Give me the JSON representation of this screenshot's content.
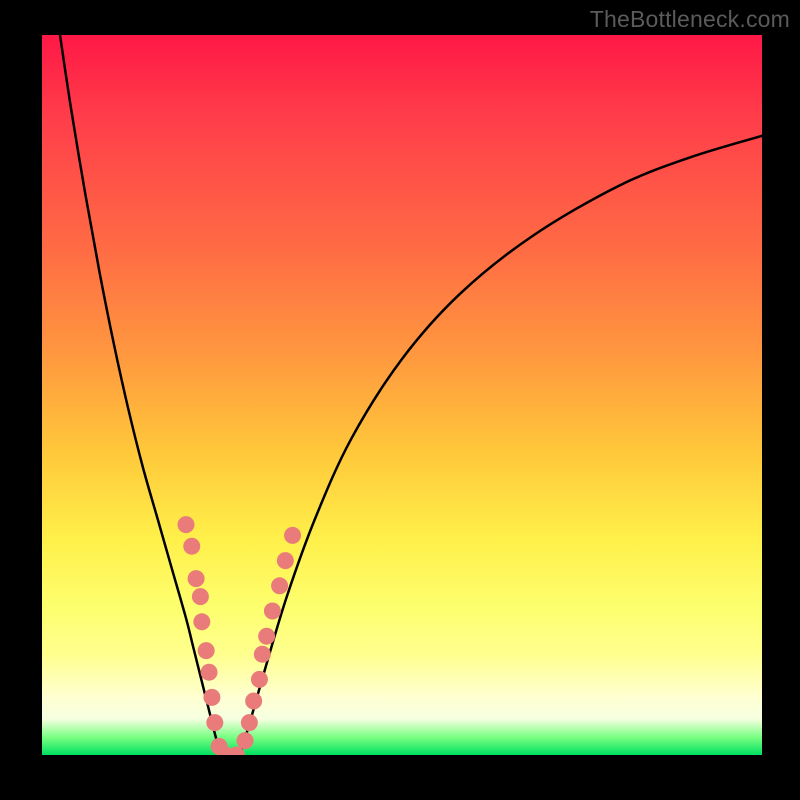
{
  "watermark": {
    "text": "TheBottleneck.com"
  },
  "chart_data": {
    "type": "line",
    "title": "",
    "xlabel": "",
    "ylabel": "",
    "xlim": [
      0,
      100
    ],
    "ylim": [
      0,
      100
    ],
    "series": [
      {
        "name": "left-curve",
        "x": [
          2.5,
          4,
          6,
          8,
          10,
          12,
          14,
          16,
          18,
          20,
          21,
          22,
          23,
          24,
          24.8
        ],
        "y": [
          100,
          90,
          78,
          67,
          57,
          48,
          40,
          33,
          26,
          19,
          15,
          11,
          7,
          3,
          0
        ]
      },
      {
        "name": "right-curve",
        "x": [
          27.5,
          29,
          31,
          34,
          38,
          43,
          50,
          58,
          68,
          80,
          90,
          100
        ],
        "y": [
          0,
          5,
          12,
          22,
          33,
          44,
          55,
          64,
          72,
          79,
          83,
          86
        ]
      },
      {
        "name": "floor",
        "x": [
          24.8,
          27.5
        ],
        "y": [
          0,
          0
        ]
      }
    ],
    "markers": [
      {
        "name": "cluster",
        "color": "#e97c7a",
        "points": [
          [
            20.0,
            32
          ],
          [
            20.8,
            29
          ],
          [
            21.4,
            24.5
          ],
          [
            22.0,
            22
          ],
          [
            22.2,
            18.5
          ],
          [
            22.8,
            14.5
          ],
          [
            23.2,
            11.5
          ],
          [
            23.6,
            8
          ],
          [
            24.0,
            4.5
          ],
          [
            24.6,
            1.2
          ],
          [
            25.5,
            0
          ],
          [
            27.0,
            0
          ],
          [
            28.2,
            2
          ],
          [
            28.8,
            4.5
          ],
          [
            29.4,
            7.5
          ],
          [
            30.2,
            10.5
          ],
          [
            30.6,
            14
          ],
          [
            31.2,
            16.5
          ],
          [
            32.0,
            20
          ],
          [
            33.0,
            23.5
          ],
          [
            33.8,
            27
          ],
          [
            34.8,
            30.5
          ]
        ]
      }
    ],
    "background_gradient": {
      "type": "vertical",
      "stops": [
        {
          "pos": 0,
          "color": "#ff1846"
        },
        {
          "pos": 70,
          "color": "#fff04a"
        },
        {
          "pos": 100,
          "color": "#00e060"
        }
      ]
    }
  }
}
